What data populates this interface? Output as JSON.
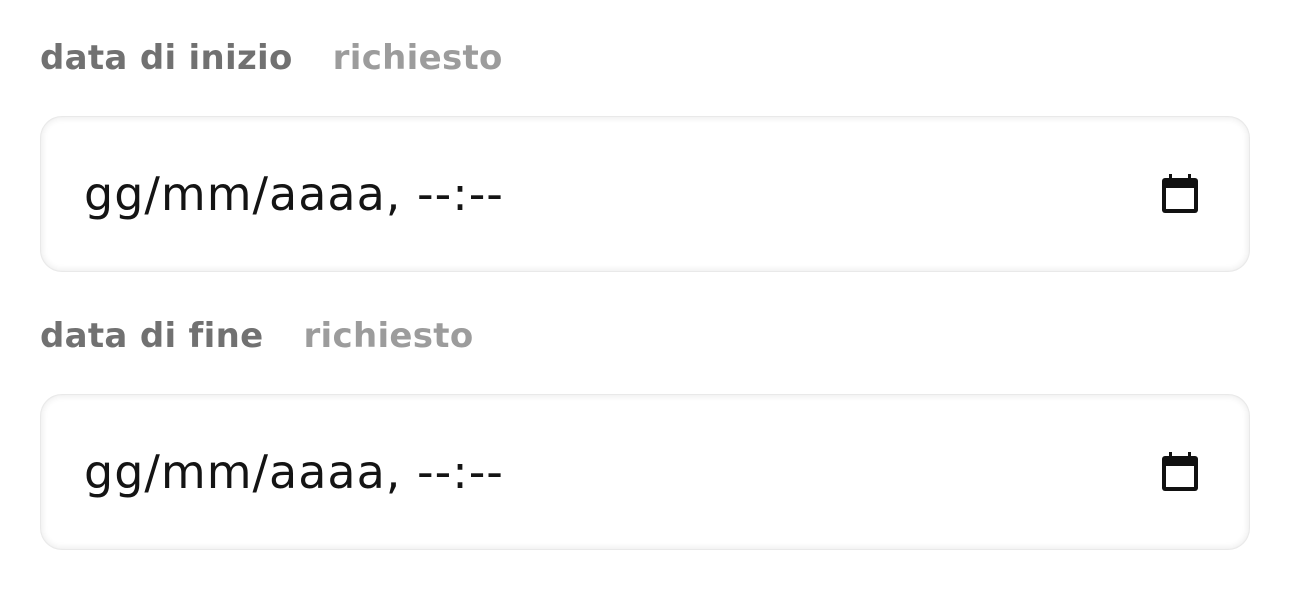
{
  "fields": [
    {
      "label": "data di inizio",
      "required_label": "richiesto",
      "value": "gg/mm/aaaa, --:--",
      "icon": "calendar-icon"
    },
    {
      "label": "data di fine",
      "required_label": "richiesto",
      "value": "gg/mm/aaaa, --:--",
      "icon": "calendar-icon"
    }
  ],
  "colors": {
    "label": "#717171",
    "required": "#9c9c9c",
    "input_text": "#141414",
    "icon": "#111111"
  }
}
